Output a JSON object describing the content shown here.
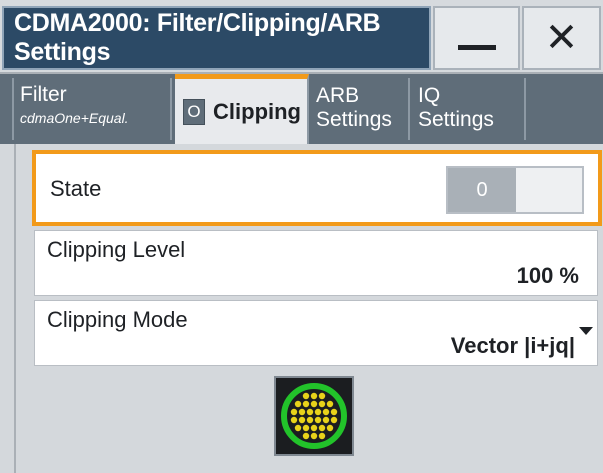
{
  "window": {
    "title": "CDMA2000: Filter/Clipping/ARB Settings",
    "minimize_icon": "minimize-icon",
    "close_icon": "close-icon",
    "close_glyph": "✕"
  },
  "tabs": [
    {
      "label": "Filter",
      "sublabel": "cdmaOne+Equal."
    },
    {
      "label": "Clipping",
      "indicator": "O",
      "active": true
    },
    {
      "label_line1": "ARB",
      "label_line2": "Settings"
    },
    {
      "label_line1": "IQ",
      "label_line2": "Settings"
    }
  ],
  "clipping": {
    "state": {
      "label": "State",
      "value": "0"
    },
    "level": {
      "label": "Clipping Level",
      "value": "100 %"
    },
    "mode": {
      "label": "Clipping Mode",
      "value": "Vector |i+jq|"
    },
    "constellation_icon": "constellation-icon"
  },
  "colors": {
    "accent": "#f29a1a",
    "title_bg": "#2c4a66",
    "tab_bg": "#5f6d79",
    "constellation_ring": "#22c32a",
    "constellation_dots": "#e8d21a"
  }
}
